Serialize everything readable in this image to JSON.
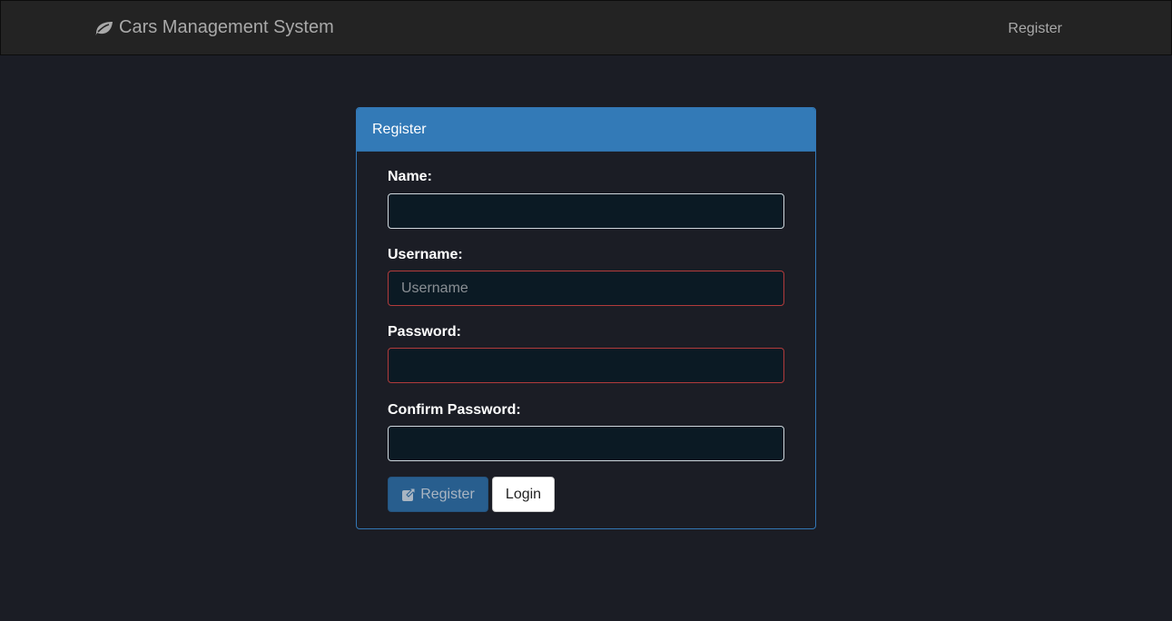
{
  "navbar": {
    "brand_icon": "leaf-icon",
    "brand_text": "Cars Management System",
    "register_link": "Register"
  },
  "panel": {
    "title": "Register",
    "fields": [
      {
        "label": "Name:",
        "value": "",
        "placeholder": ""
      },
      {
        "label": "Username:",
        "value": "",
        "placeholder": "Username"
      },
      {
        "label": "Password:",
        "value": "",
        "placeholder": ""
      },
      {
        "label": "Confirm Password:",
        "value": "",
        "placeholder": ""
      }
    ],
    "register_button": {
      "label": "Register",
      "icon": "external-link-icon"
    },
    "login_button": {
      "label": "Login"
    }
  },
  "colors": {
    "background": "#1b1d25",
    "navbar": "#232323",
    "panel_heading": "#337ab7",
    "input_background": "#0b1a24",
    "error_border": "#b23b3b",
    "register_button": "#285e8e"
  }
}
